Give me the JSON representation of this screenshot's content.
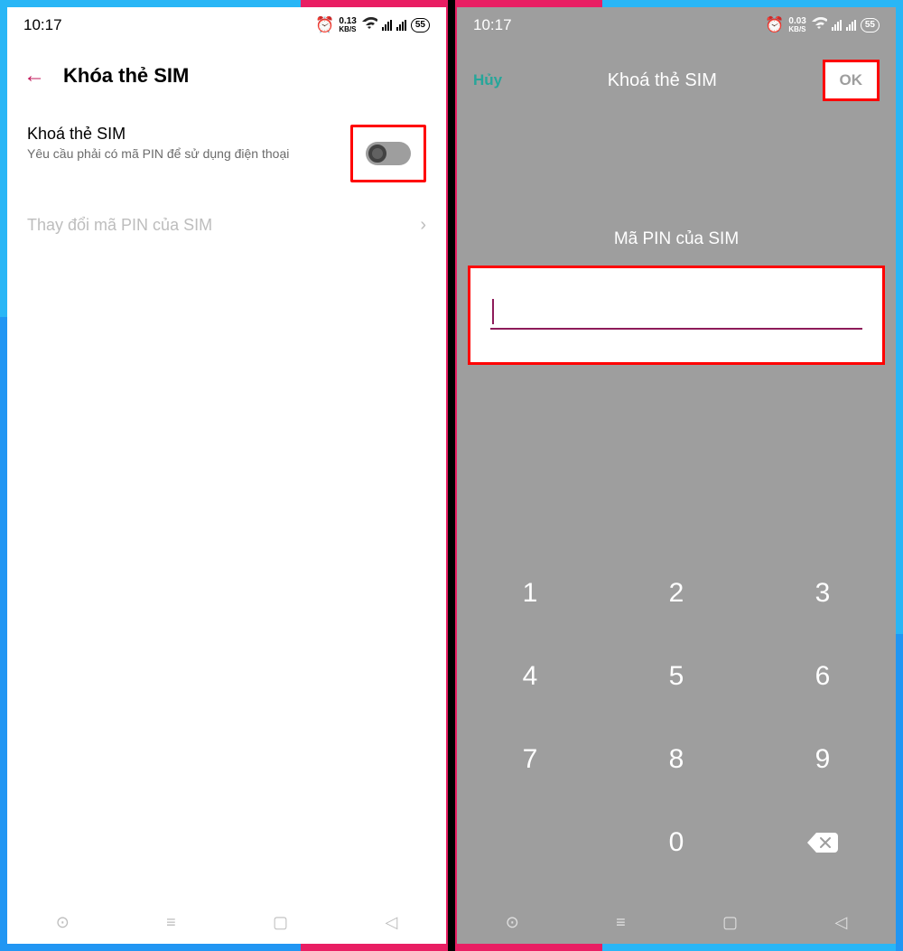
{
  "left": {
    "status": {
      "time": "10:17",
      "speed_top": "0.13",
      "speed_bot": "KB/S",
      "battery": "55"
    },
    "header": {
      "title": "Khóa thẻ SIM"
    },
    "lock": {
      "title": "Khoá thẻ SIM",
      "subtitle": "Yêu cầu phải có mã PIN để sử dụng điện thoại"
    },
    "change_pin": "Thay đổi mã PIN của SIM"
  },
  "right": {
    "status": {
      "time": "10:17",
      "speed_top": "0.03",
      "speed_bot": "KB/S",
      "battery": "55"
    },
    "header": {
      "cancel": "Hủy",
      "title": "Khoá thẻ SIM",
      "ok": "OK"
    },
    "prompt": "Mã PIN của SIM",
    "keypad": [
      "1",
      "2",
      "3",
      "4",
      "5",
      "6",
      "7",
      "8",
      "9",
      "",
      "0",
      ""
    ]
  }
}
